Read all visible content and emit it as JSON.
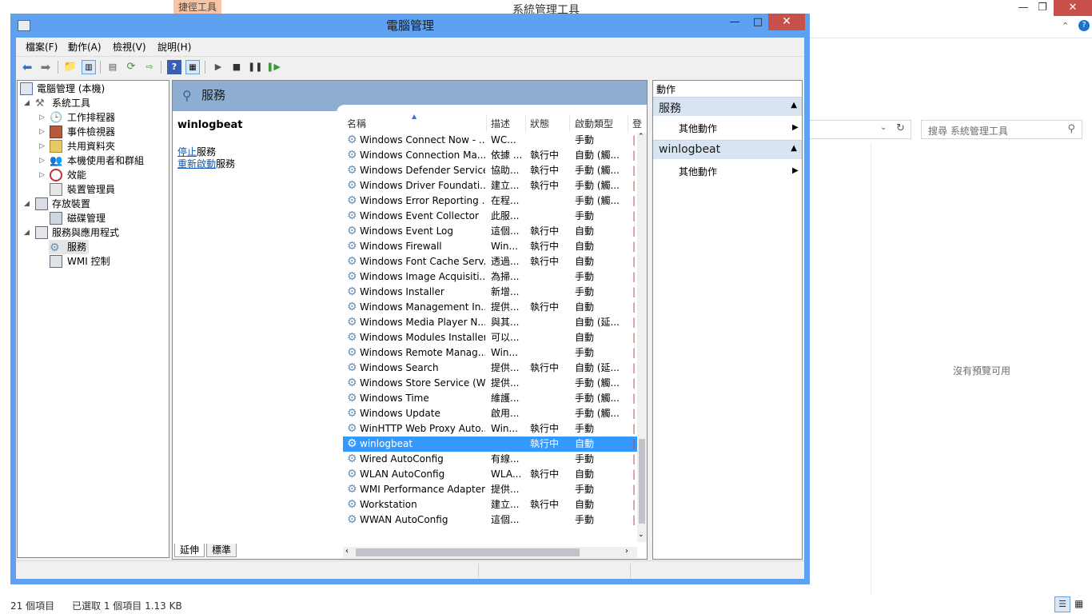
{
  "background": {
    "title": "系統管理工具",
    "context_tab": "捷徑工具",
    "search_placeholder": "搜尋 系統管理工具",
    "preview_text": "沒有預覽可用",
    "status_items": "21 個項目",
    "status_selected": "已選取 1 個項目  1.13 KB"
  },
  "window": {
    "title": "電腦管理",
    "minimize": "—",
    "maximize": "□",
    "close": "✕"
  },
  "menu": [
    "檔案(F)",
    "動作(A)",
    "檢視(V)",
    "說明(H)"
  ],
  "tree": {
    "root": "電腦管理 (本機)",
    "system_tools": "系統工具",
    "task_scheduler": "工作排程器",
    "event_viewer": "事件檢視器",
    "shared_folders": "共用資料夾",
    "local_users": "本機使用者和群組",
    "performance": "效能",
    "device_manager": "裝置管理員",
    "storage": "存放裝置",
    "disk_management": "磁碟管理",
    "services_apps": "服務與應用程式",
    "services": "服務",
    "wmi": "WMI 控制"
  },
  "center": {
    "header": "服務",
    "selected_service": "winlogbeat",
    "stop_link": "停止",
    "stop_suffix": "服務",
    "restart_link": "重新啟動",
    "restart_suffix": "服務",
    "columns": [
      "名稱",
      "描述",
      "狀態",
      "啟動類型"
    ],
    "tabs": [
      "延伸",
      "標準"
    ],
    "rows": [
      {
        "name": "Windows Connect Now - ...",
        "desc": "WC...",
        "status": "",
        "startup": "手動"
      },
      {
        "name": "Windows Connection Ma...",
        "desc": "依據 ...",
        "status": "執行中",
        "startup": "自動 (觸..."
      },
      {
        "name": "Windows Defender Service",
        "desc": "協助...",
        "status": "執行中",
        "startup": "手動 (觸..."
      },
      {
        "name": "Windows Driver Foundati...",
        "desc": "建立...",
        "status": "執行中",
        "startup": "手動 (觸..."
      },
      {
        "name": "Windows Error Reporting ...",
        "desc": "在程...",
        "status": "",
        "startup": "手動 (觸..."
      },
      {
        "name": "Windows Event Collector",
        "desc": "此服...",
        "status": "",
        "startup": "手動"
      },
      {
        "name": "Windows Event Log",
        "desc": "這個...",
        "status": "執行中",
        "startup": "自動"
      },
      {
        "name": "Windows Firewall",
        "desc": "Win...",
        "status": "執行中",
        "startup": "自動"
      },
      {
        "name": "Windows Font Cache Serv...",
        "desc": "透過...",
        "status": "執行中",
        "startup": "自動"
      },
      {
        "name": "Windows Image Acquisiti...",
        "desc": "為掃...",
        "status": "",
        "startup": "手動"
      },
      {
        "name": "Windows Installer",
        "desc": "新增...",
        "status": "",
        "startup": "手動"
      },
      {
        "name": "Windows Management In...",
        "desc": "提供...",
        "status": "執行中",
        "startup": "自動"
      },
      {
        "name": "Windows Media Player N...",
        "desc": "與其...",
        "status": "",
        "startup": "自動 (延..."
      },
      {
        "name": "Windows Modules Installer",
        "desc": "可以...",
        "status": "",
        "startup": "自動"
      },
      {
        "name": "Windows Remote Manag...",
        "desc": "Win...",
        "status": "",
        "startup": "手動"
      },
      {
        "name": "Windows Search",
        "desc": "提供...",
        "status": "執行中",
        "startup": "自動 (延..."
      },
      {
        "name": "Windows Store Service (W...",
        "desc": "提供...",
        "status": "",
        "startup": "手動 (觸..."
      },
      {
        "name": "Windows Time",
        "desc": "維護...",
        "status": "",
        "startup": "手動 (觸..."
      },
      {
        "name": "Windows Update",
        "desc": "啟用...",
        "status": "",
        "startup": "手動 (觸..."
      },
      {
        "name": "WinHTTP Web Proxy Auto...",
        "desc": "Win...",
        "status": "執行中",
        "startup": "手動"
      },
      {
        "name": "winlogbeat",
        "desc": "",
        "status": "執行中",
        "startup": "自動",
        "selected": true
      },
      {
        "name": "Wired AutoConfig",
        "desc": "有線...",
        "status": "",
        "startup": "手動"
      },
      {
        "name": "WLAN AutoConfig",
        "desc": "WLA...",
        "status": "執行中",
        "startup": "自動"
      },
      {
        "name": "WMI Performance Adapter",
        "desc": "提供...",
        "status": "",
        "startup": "手動"
      },
      {
        "name": "Workstation",
        "desc": "建立...",
        "status": "執行中",
        "startup": "自動"
      },
      {
        "name": "WWAN AutoConfig",
        "desc": "這個...",
        "status": "",
        "startup": "手動"
      }
    ]
  },
  "actions": {
    "title": "動作",
    "group1": "服務",
    "group1_item": "其他動作",
    "group2": "winlogbeat",
    "group2_item": "其他動作"
  },
  "colors": {
    "window_frame": "#5ea1f0",
    "selection": "#3399ff",
    "header_band": "#8eaed1",
    "close_red": "#c7504b"
  }
}
